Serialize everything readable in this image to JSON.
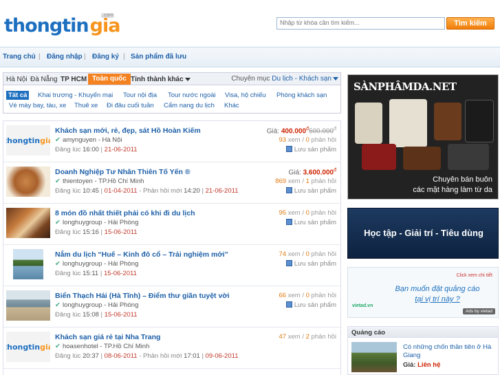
{
  "header": {
    "logo_part1": "thongtin",
    "logo_part2": "gia",
    "logo_tld": ".com",
    "search_placeholder": "Nhập từ khóa cần tìm kiếm...",
    "search_button": "Tìm kiếm"
  },
  "nav": {
    "items": [
      "Trang chủ",
      "Đăng nhập",
      "Đăng ký",
      "Sản phẩm đã lưu"
    ]
  },
  "filter": {
    "cities": [
      "Hà Nội",
      "Đà Nẵng",
      "TP HCM",
      "Toàn quốc",
      "Tỉnh thành khác"
    ],
    "active_city": "Toàn quốc",
    "category_label": "Chuyên mục",
    "category_value": "Du lịch - Khách sạn",
    "subcats_row1": [
      "Tất cả",
      "Khai trương - Khuyến mại",
      "Tour nội địa",
      "Tour nước ngoài",
      "Visa, hộ chiếu",
      "Phòng khách sạn"
    ],
    "subcats_row2": [
      "Vé máy bay, tàu, xe",
      "Thuê xe",
      "Đi đâu cuối tuần",
      "Cẩm nang du lịch",
      "Khác"
    ]
  },
  "listings": [
    {
      "title": "Khách sạn mới, rẻ, đẹp, sát Hồ Hoàn Kiếm",
      "seller": "amynguyen - Hà Nội",
      "posted_label": "Đăng lúc",
      "posted_time": "16:00",
      "posted_date": "21-06-2011",
      "reply_label": "",
      "reply_time": "",
      "reply_date": "",
      "price_label": "Giá:",
      "price": "400.000",
      "price_old": "500.000",
      "views": "93",
      "replies": "0",
      "views_label": "xem",
      "replies_label": "phản hồi",
      "save_label": "Lưu sản phẩm",
      "thumb": "logo"
    },
    {
      "title": "Doanh Nghiệp Tư Nhân Thiên Tố Yến ®",
      "seller": "thientoyen - TP.Hồ Chí Minh",
      "posted_label": "Đăng lúc",
      "posted_time": "10:45",
      "posted_date": "01-04-2011",
      "reply_label": "Phản hồi mới",
      "reply_time": "14:20",
      "reply_date": "21-06-2011",
      "price_label": "Giá:",
      "price": "3.600.000",
      "price_old": "",
      "views": "869",
      "replies": "1",
      "views_label": "xem",
      "replies_label": "phản hồi",
      "save_label": "Lưu sản phẩm",
      "thumb": "nest"
    },
    {
      "title": "8 món đồ nhất thiết phải có khi đi du lịch",
      "seller": "longhuygroup - Hải Phòng",
      "posted_label": "Đăng lúc",
      "posted_time": "15:16",
      "posted_date": "15-06-2011",
      "reply_label": "",
      "reply_time": "",
      "reply_date": "",
      "price_label": "",
      "price": "",
      "price_old": "",
      "views": "95",
      "replies": "0",
      "views_label": "xem",
      "replies_label": "phản hồi",
      "save_label": "Lưu sản phẩm",
      "thumb": "items"
    },
    {
      "title": "Nắm du lịch “Huế – Kinh đô cổ – Trải nghiệm mới”",
      "seller": "longhuygroup - Hải Phòng",
      "posted_label": "Đăng lúc",
      "posted_time": "15:11",
      "posted_date": "15-06-2011",
      "reply_label": "",
      "reply_time": "",
      "reply_date": "",
      "price_label": "",
      "price": "",
      "price_old": "",
      "views": "74",
      "replies": "0",
      "views_label": "xem",
      "replies_label": "phản hồi",
      "save_label": "Lưu sản phẩm",
      "thumb": "river"
    },
    {
      "title": "Biển Thạch Hải (Hà Tĩnh) – Điểm thư giãn tuyệt vời",
      "seller": "longhuygroup - Hải Phòng",
      "posted_label": "Đăng lúc",
      "posted_time": "15:08",
      "posted_date": "15-06-2011",
      "reply_label": "",
      "reply_time": "",
      "reply_date": "",
      "price_label": "",
      "price": "",
      "price_old": "",
      "views": "66",
      "replies": "0",
      "views_label": "xem",
      "replies_label": "phản hồi",
      "save_label": "Lưu sản phẩm",
      "thumb": "sea"
    },
    {
      "title": "Khách sạn giá rẻ tại Nha Trang",
      "seller": "hoasenhotel - TP.Hồ Chí Minh",
      "posted_label": "Đăng lúc",
      "posted_time": "20:37",
      "posted_date": "08-06-2011",
      "reply_label": "Phản hồi mới",
      "reply_time": "17:01",
      "reply_date": "09-06-2011",
      "price_label": "",
      "price": "",
      "price_old": "",
      "views": "47",
      "replies": "2",
      "views_label": "xem",
      "replies_label": "phản hồi",
      "save_label": "",
      "thumb": "logo"
    }
  ],
  "ads": {
    "ad1_brand": "SÀNPHÂMDA.NET",
    "ad1_caption1": "Chuyên bán buôn",
    "ad1_caption2": "các mặt hàng làm từ da",
    "ad2_text": "Học tập - Giải trí - Tiêu dùng",
    "ad3_link": "Click xem chi tiết",
    "ad3_line1": "Bạn muốn đặt quảng cáo",
    "ad3_line2": "tại vị trí này ?",
    "ad3_logo": "vietad.vn",
    "ad3_by": "Ads by vietad"
  },
  "quangcao": {
    "heading": "Quảng cáo",
    "title_line1": "Có những chốn thần tiên ở Hà",
    "title_line2": "Giang",
    "price_label": "Giá:",
    "price_value": "Liên hệ"
  },
  "colors": {
    "brand_blue": "#1d6fc0",
    "brand_orange": "#f7941d",
    "price_red": "#cc2200"
  }
}
